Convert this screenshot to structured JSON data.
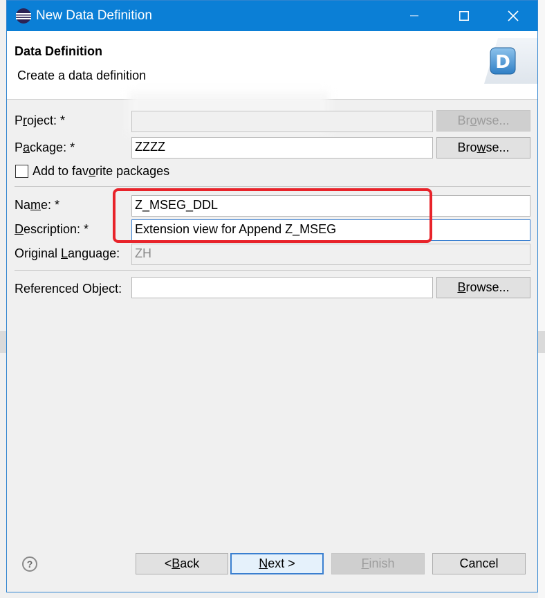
{
  "window": {
    "title": "New Data Definition",
    "controls": {
      "minimize": "minimize",
      "maximize": "maximize",
      "close": "close"
    }
  },
  "banner": {
    "title": "Data Definition",
    "subtitle": "Create a data definition",
    "logo_letter": "D"
  },
  "form": {
    "project": {
      "label_pre": "P",
      "label_u": "r",
      "label_post": "oject: *",
      "value": "",
      "browse_pre": "Br",
      "browse_u": "o",
      "browse_post": "wse..."
    },
    "package": {
      "label_pre": "P",
      "label_u": "a",
      "label_post": "ckage: *",
      "value": "ZZZZ",
      "browse_pre": "Bro",
      "browse_u": "w",
      "browse_post": "se..."
    },
    "favorite": {
      "label_pre": "Add to fav",
      "label_u": "o",
      "label_post": "rite packages",
      "checked": false
    },
    "name": {
      "label_pre": "Na",
      "label_u": "m",
      "label_post": "e: *",
      "value": "Z_MSEG_DDL"
    },
    "description": {
      "label_pre": "",
      "label_u": "D",
      "label_post": "escription: *",
      "value": "Extension view for Append Z_MSEG"
    },
    "language": {
      "label_pre": "Original ",
      "label_u": "L",
      "label_post": "anguage:",
      "value": "ZH"
    },
    "referenced": {
      "label": "Referenced Object:",
      "value": "",
      "browse_pre": "",
      "browse_u": "B",
      "browse_post": "rowse..."
    }
  },
  "footer": {
    "help_glyph": "?",
    "back_pre": "< ",
    "back_u": "B",
    "back_post": "ack",
    "next_pre": "",
    "next_u": "N",
    "next_post": "ext >",
    "finish_pre": "",
    "finish_u": "F",
    "finish_post": "inish",
    "cancel": "Cancel"
  },
  "colors": {
    "titlebar": "#0b7fd6",
    "highlight": "#e8232a",
    "default_button_border": "#3a7fd0"
  }
}
